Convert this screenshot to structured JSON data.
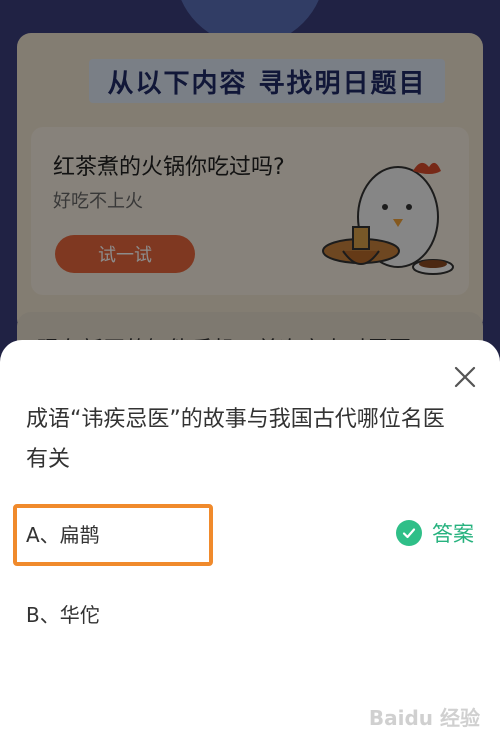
{
  "background": {
    "banner_title": "从以下内容  寻找明日题目",
    "quiz_card": {
      "question": "红茶煮的火锅你吃过吗?",
      "hint": "好吃不上火",
      "try_button": "试一试"
    },
    "next_card_text": "现在新买的智能手机，首次充电时需要"
  },
  "sheet": {
    "question": "成语“讳疾忌医”的故事与我国古代哪位名医有关",
    "options": [
      {
        "label": "A、扁鹊",
        "is_answer": true
      },
      {
        "label": "B、华佗",
        "is_answer": false
      }
    ],
    "answer_label": "答案"
  },
  "watermark": "Baidu 经验",
  "colors": {
    "accent_green": "#2fbf88",
    "highlight_orange": "#f08a2c",
    "button_orange": "#e8673c",
    "banner_text": "#1f2a66"
  },
  "icons": {
    "close": "close-icon",
    "check": "check-circle-icon"
  }
}
